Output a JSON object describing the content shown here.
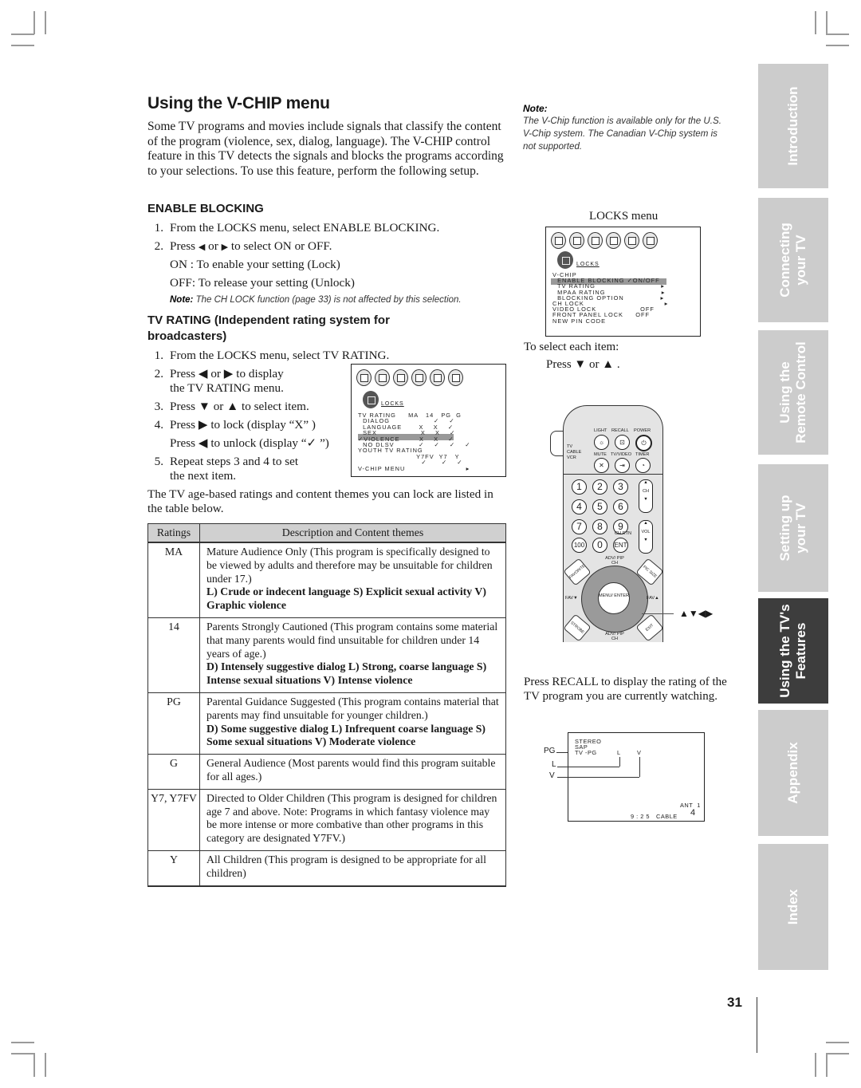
{
  "page": {
    "title": "Using the V-CHIP menu",
    "intro": "Some TV programs and movies include signals that classify the content of the program (violence, sex, dialog, language). The V-CHIP control feature in this TV detects the signals and blocks the programs according to your selections. To use this feature, perform the following setup.",
    "page_number": "31"
  },
  "enable_blocking": {
    "heading": "ENABLE BLOCKING",
    "steps": [
      {
        "num": "1.",
        "text": "From the LOCKS menu, select ENABLE BLOCKING."
      },
      {
        "num": "2.",
        "pre": "Press ",
        "left": "◀",
        "mid": " or ",
        "right": "▶",
        "post": " to select ON or OFF."
      }
    ],
    "on_text": "ON : To enable your setting (Lock)",
    "off_text": "OFF: To release your setting (Unlock)",
    "note_label": "Note:",
    "note_text": " The CH LOCK function (page 33) is not affected by this selection."
  },
  "tv_rating": {
    "heading_line1": "TV RATING (Independent rating system for",
    "heading_line2": "broadcasters)",
    "step1": "From the LOCKS menu, select TV RATING.",
    "step2a": "Press ◀ or ▶ to display",
    "step2b": "the TV RATING menu.",
    "step3": "Press ▼ or ▲ to select item.",
    "step4a": "Press ▶ to lock (display “X” )",
    "step4b": "Press ◀ to unlock (display “✓ ”)",
    "step5a": "Repeat steps 3 and 4 to set",
    "step5b": "the next item.",
    "nums": [
      "1.",
      "2.",
      "3.",
      "4.",
      "5."
    ],
    "table_intro": "The TV age-based ratings and content themes you can lock are listed in the table below."
  },
  "ratings_table": {
    "headers": [
      "Ratings",
      "Description and Content themes"
    ],
    "rows": [
      {
        "rating": "MA",
        "description": "Mature Audience Only (This program is specifically designed to be viewed by adults and therefore may be unsuitable for children under 17.)",
        "themes": "L) Crude or indecent language  S) Explicit sexual activity  V) Graphic violence"
      },
      {
        "rating": "14",
        "description": "Parents Strongly Cautioned (This program contains some material that many parents would find unsuitable for children under 14 years of age.)",
        "themes": "D) Intensely suggestive dialog  L) Strong, coarse language  S) Intense sexual situations  V) Intense violence"
      },
      {
        "rating": "PG",
        "description": "Parental Guidance Suggested (This program contains material that parents may find unsuitable for younger children.)",
        "themes": "D) Some suggestive dialog  L) Infrequent coarse language  S) Some sexual situations  V) Moderate violence"
      },
      {
        "rating": "G",
        "description": "General Audience (Most parents would find this program suitable for all ages.)",
        "themes": ""
      },
      {
        "rating": "Y7, Y7FV",
        "description": "Directed to Older Children (This program is designed for children age 7 and above. Note: Programs in which fantasy violence may be more intense or more combative than other programs in this category are designated Y7FV.)",
        "themes": ""
      },
      {
        "rating": "Y",
        "description": "All Children (This program is designed to be appropriate for all children)",
        "themes": ""
      }
    ]
  },
  "side_note": {
    "label": "Note:",
    "text": "The V-Chip function is available only for the U.S. V-Chip system. The Canadian V-Chip system is not supported."
  },
  "locks_menu": {
    "caption": "LOCKS menu",
    "section_label": "LOCKS",
    "rows": [
      "V-CHIP",
      "  ENABLE BLOCKING ✓ON/OFF",
      "  TV RATING                           ▸",
      "  MPAA RATING                       ▸",
      "  BLOCKING OPTION               ▸",
      "CH LOCK                                 ▸",
      "VIDEO LOCK                  OFF",
      "FRONT PANEL LOCK     OFF",
      "NEW PIN CODE"
    ],
    "selected_value": "ON"
  },
  "tv_rating_menu": {
    "section_label": "LOCKS",
    "rows": [
      "TV RATING     MA   14   PG  G",
      "  DIALOG                  ✓    ✓",
      "  LANGUAGE       X    X    ✓",
      "  SEX                  X    X    ✓",
      "✓VIOLENCE        X    X    ✓",
      "  NO DLSV          ✓    ✓    ✓    ✓",
      "YOUTH TV RATING",
      "                        Y7FV  Y7   Y",
      "                          ✓      ✓    ✓",
      "V-CHIP MENU                         ▸"
    ]
  },
  "remote_caption": {
    "line1": "To select each item:",
    "line2": "Press ▼ or ▲ ."
  },
  "remote": {
    "labels": {
      "light": "LIGHT",
      "recall": "RECALL",
      "power": "POWER",
      "mute": "MUTE",
      "tvvideo": "TV/VIDEO",
      "timer": "TIMER",
      "tv": "TV",
      "cable": "CABLE",
      "vcr": "VCR",
      "ch": "CH",
      "vol": "VOL",
      "chrtn": "CH RTN",
      "adv_top": "ADV/ PIP CH",
      "adv_bottom": "ADV/ PIP CH",
      "fav_down": "FAV▼",
      "fav_up": "FAV▲",
      "menu": "MENU/ ENTER",
      "favorite": "FAVORITE",
      "picsize": "PIC SIZE",
      "strobe": "STROBE",
      "exit": "EXIT"
    },
    "digits": [
      "1",
      "2",
      "3",
      "4",
      "5",
      "6",
      "7",
      "8",
      "9",
      "100",
      "0",
      "ENT"
    ],
    "arrows_callout": "▲▼◀▶"
  },
  "recall_text": "Press RECALL to display the rating of the TV program you are currently watching.",
  "recall_screen": {
    "stereo": "STEREO",
    "sap": "SAP",
    "rating": "TV -PG",
    "l": "L",
    "v": "V",
    "callout_pg": "PG",
    "callout_l": "L",
    "callout_v": "V",
    "ant": "ANT  1",
    "time": "9 : 2 5",
    "cable": "CABLE",
    "channel": "4"
  },
  "side_tabs": [
    {
      "label": "Introduction",
      "active": false
    },
    {
      "label": "Connecting\nyour TV",
      "active": false
    },
    {
      "label": "Using the\nRemote Control",
      "active": false
    },
    {
      "label": "Setting up\nyour TV",
      "active": false
    },
    {
      "label": "Using the TV's\nFeatures",
      "active": true
    },
    {
      "label": "Appendix",
      "active": false
    },
    {
      "label": "Index",
      "active": false
    }
  ]
}
